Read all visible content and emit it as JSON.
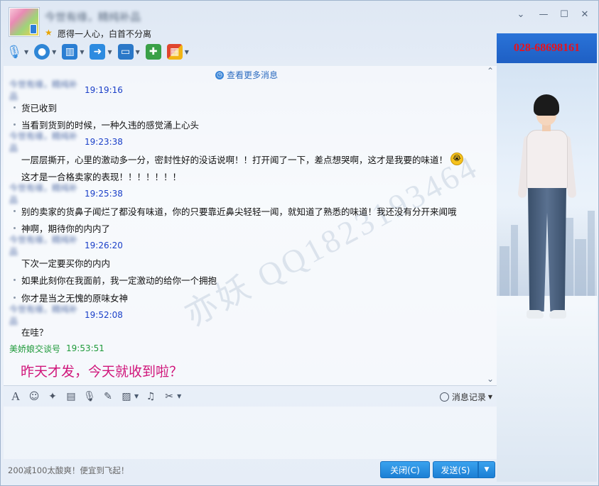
{
  "header": {
    "contact_name": "今世有缘，精纯补品",
    "signature": "愿得一人心，白首不分离"
  },
  "window_controls": [
    "chevron-down-icon",
    "minimize-icon",
    "maximize-icon",
    "close-icon"
  ],
  "top_toolbar": [
    {
      "name": "voice-call",
      "icon": "microphone-icon",
      "color": "#3a8fe0"
    },
    {
      "name": "video-call",
      "icon": "camera-icon",
      "color": "#2f86d6"
    },
    {
      "name": "remote-desktop",
      "icon": "presentation-icon",
      "color": "#2a7ed3"
    },
    {
      "name": "send-file",
      "icon": "folder-send-icon",
      "color": "#2d8be0"
    },
    {
      "name": "screen-share",
      "icon": "monitor-icon",
      "color": "#2b78c8"
    },
    {
      "name": "create-discussion",
      "icon": "chat-add-icon",
      "color": "#3aa047"
    },
    {
      "name": "apps",
      "icon": "apps-grid-icon",
      "color": "#e0462f"
    }
  ],
  "chat": {
    "more_messages": "查看更多消息",
    "watermark": "亦妖 QQ1823193464",
    "messages": [
      {
        "sender": "今世有缘，精纯补品",
        "time": "19:19:16",
        "lines": [
          "货已收到",
          "当看到货到的时候，一种久违的感觉涌上心头"
        ]
      },
      {
        "sender": "今世有缘，精纯补品",
        "time": "19:23:38",
        "lines": [
          "一层层撕开，心里的激动多一分，密封性好的没话说啊！！打开闻了一下，差点想哭啊，这才是我要的味道！",
          "这才是一合格卖家的表现！！！！！！！"
        ]
      },
      {
        "sender": "今世有缘，精纯补品",
        "time": "19:25:38",
        "lines": [
          "别的卖家的货鼻子闻烂了都没有味道，你的只要靠近鼻尖轻轻一闻，就知道了熟悉的味道！我还没有分开来闻哦",
          "神啊，期待你的内内了"
        ]
      },
      {
        "sender": "今世有缘，精纯补品",
        "time": "19:26:20",
        "lines": [
          "下次一定要买你的内内",
          "如果此刻你在我面前，我一定激动的给你一个拥抱",
          "你才是当之无愧的原味女神"
        ]
      },
      {
        "sender": "今世有缘，精纯补品",
        "time": "19:52:08",
        "lines": [
          "在哇？"
        ]
      }
    ],
    "own_message": {
      "sender": "美娇娘交谈号",
      "time": "19:53:51",
      "text": "昨天才发，今天就收到啦？"
    }
  },
  "input_toolbar": {
    "icons": [
      "font-icon",
      "emoji-icon",
      "magic-icon",
      "video-clip-icon",
      "mic-icon",
      "edit-icon",
      "image-icon",
      "music-icon",
      "scissors-icon"
    ],
    "history_label": "消息记录"
  },
  "bottom": {
    "ad_text": "200减100太酸爽！便宜到飞起！",
    "close_label": "关闭(C)",
    "send_label": "发送(S)"
  },
  "side_panel": {
    "phone": "028-68698161"
  }
}
